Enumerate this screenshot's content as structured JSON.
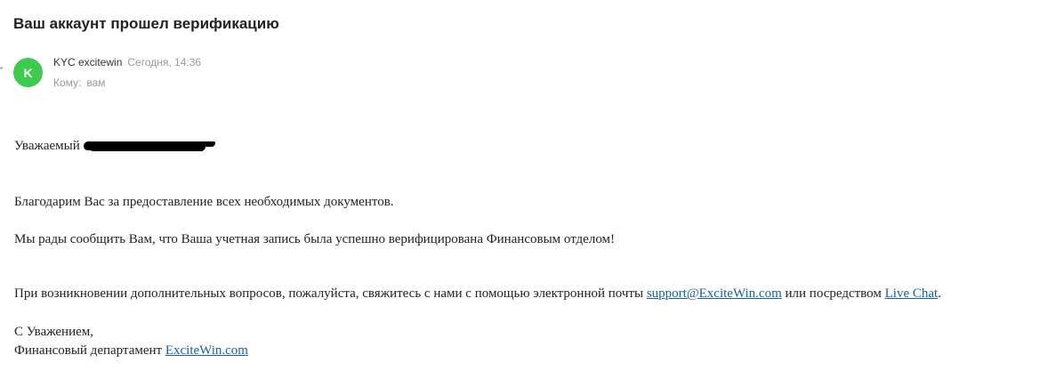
{
  "email": {
    "subject": "Ваш аккаунт прошел верификацию",
    "sender": {
      "avatar_letter": "K",
      "avatar_color": "#3ec94f",
      "name": "KYC excitewin",
      "time": "Сегодня, 14:36"
    },
    "recipient": {
      "label": "Кому:",
      "value": "вам"
    },
    "body": {
      "greeting_prefix": "Уважаемый",
      "greeting_suffix": ",",
      "thanks": "Благодарим Вас за предоставление всех необходимых документов.",
      "verified": "Мы рады сообщить Вам, что Ваша учетная запись была успешно верифицирована Финансовым отделом!",
      "contact_text_1": "При возникновении дополнительных вопросов, пожалуйста, свяжитесь с нами с помощью электронной почты",
      "contact_email": "support@ExciteWin.com",
      "contact_text_2": "или посредством",
      "contact_chat": "Live Chat",
      "contact_end": ".",
      "sign_off": "С Уважением,",
      "signature_prefix": "Финансовый департамент",
      "signature_link": "ExciteWin.com"
    },
    "link_color": "#1a5f9e"
  }
}
